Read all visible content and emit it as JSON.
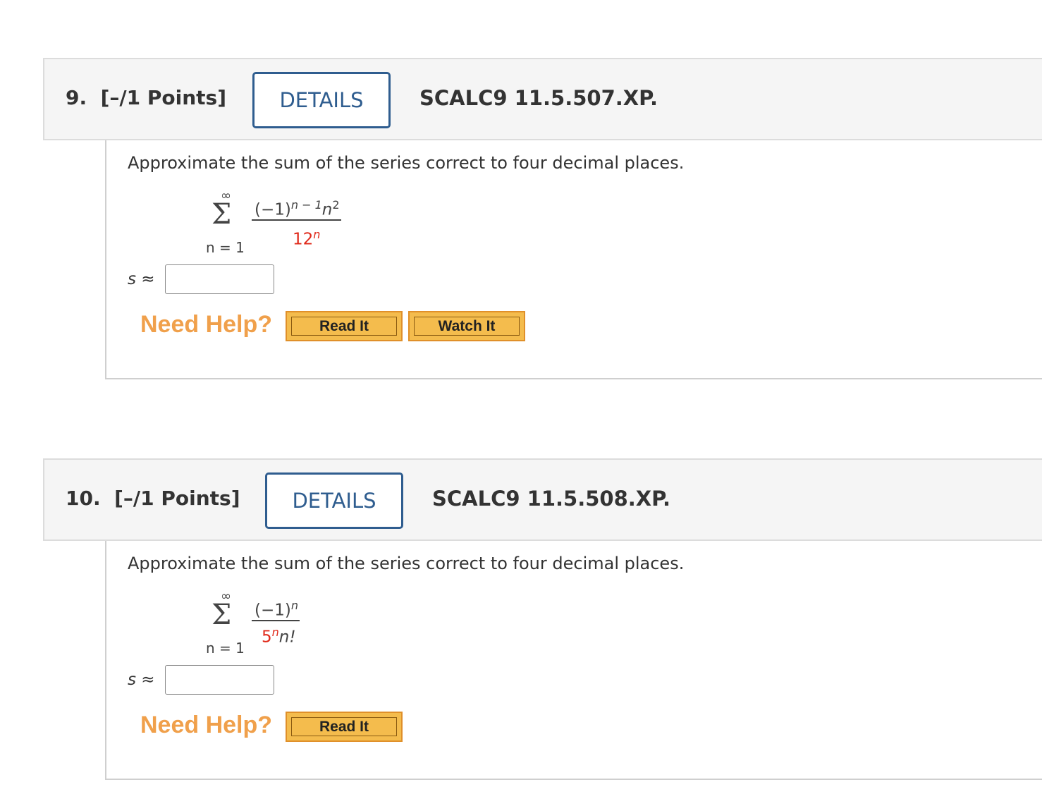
{
  "questions": [
    {
      "number_label": "9.",
      "points_label": "[–/1 Points]",
      "details_label": "DETAILS",
      "code": "SCALC9 11.5.507.XP.",
      "prompt": "Approximate the sum of the series correct to four decimal places.",
      "series": {
        "upper": "∞",
        "lower": "n = 1",
        "numerator_base": "(−1)",
        "numerator_exp": "n − 1",
        "numerator_tail": "n",
        "numerator_tail_exp": "2",
        "denominator_base": "12",
        "denominator_exp": "n",
        "denominator_tail": ""
      },
      "answer_label": "s ≈",
      "answer_value": "",
      "need_help": "Need Help?",
      "help_buttons": [
        "Read It",
        "Watch It"
      ]
    },
    {
      "number_label": "10.",
      "points_label": "[–/1 Points]",
      "details_label": "DETAILS",
      "code": "SCALC9 11.5.508.XP.",
      "prompt": "Approximate the sum of the series correct to four decimal places.",
      "series": {
        "upper": "∞",
        "lower": "n = 1",
        "numerator_base": "(−1)",
        "numerator_exp": "n",
        "denominator_base": "5",
        "denominator_exp": "n",
        "denominator_tail": "n!"
      },
      "answer_label": "s ≈",
      "answer_value": "",
      "need_help": "Need Help?",
      "help_buttons": [
        "Read It"
      ]
    }
  ],
  "colors": {
    "details_blue": "#2f5d8f",
    "highlight_red": "#e0291a",
    "need_help_orange": "#f0a04b",
    "help_button_fill": "#f4bc4d"
  }
}
